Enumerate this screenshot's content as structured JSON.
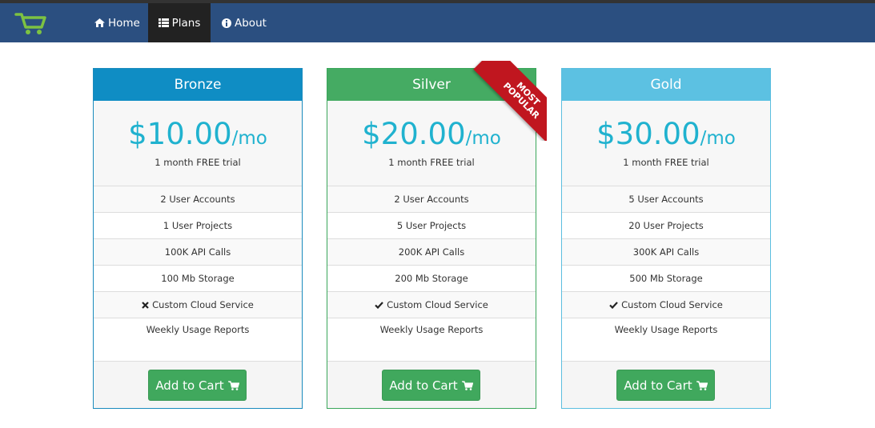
{
  "nav": {
    "items": [
      {
        "label": "Home",
        "icon": "home-icon"
      },
      {
        "label": "Plans",
        "icon": "list-icon",
        "active": true
      },
      {
        "label": "About",
        "icon": "info-icon"
      }
    ],
    "logo_icon": "cart-logo-icon"
  },
  "plans": [
    {
      "name": "Bronze",
      "price": "$10.00",
      "period": "/mo",
      "trial": "1 month FREE trial",
      "features": [
        "2 User Accounts",
        "1 User Projects",
        "100K API Calls",
        "100 Mb Storage",
        "Custom Cloud Service",
        "Weekly Usage Reports"
      ],
      "cloud_included": false,
      "button": "Add to Cart"
    },
    {
      "name": "Silver",
      "price": "$20.00",
      "period": "/mo",
      "trial": "1 month FREE trial",
      "features": [
        "2 User Accounts",
        "5 User Projects",
        "200K API Calls",
        "200 Mb Storage",
        "Custom Cloud Service",
        "Weekly Usage Reports"
      ],
      "cloud_included": true,
      "button": "Add to Cart",
      "ribbon": {
        "line1": "MOST",
        "line2": "POPULAR"
      }
    },
    {
      "name": "Gold",
      "price": "$30.00",
      "period": "/mo",
      "trial": "1 month FREE trial",
      "features": [
        "5 User Accounts",
        "20 User Projects",
        "300K API Calls",
        "500 Mb Storage",
        "Custom Cloud Service",
        "Weekly Usage Reports"
      ],
      "cloud_included": true,
      "button": "Add to Cart"
    }
  ],
  "colors": {
    "navbar": "#2b4f80",
    "bronze": "#0f8dc4",
    "silver": "#45ab63",
    "gold": "#5cc1e2",
    "price": "#20b2cf",
    "button": "#40a85d",
    "ribbon": "#c0161f"
  }
}
